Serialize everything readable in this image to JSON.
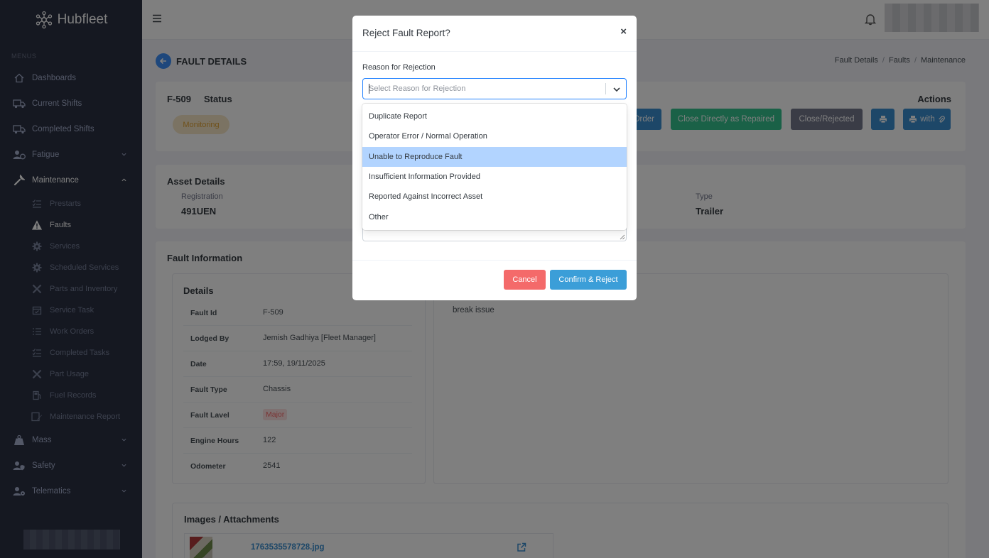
{
  "app": {
    "name": "Hubfleet"
  },
  "sidebar": {
    "menu_title": "MENUS",
    "items": [
      {
        "label": "Dashboards",
        "icon": "home-icon"
      },
      {
        "label": "Current Shifts",
        "icon": "truck-icon"
      },
      {
        "label": "Completed Shifts",
        "icon": "truck-icon"
      },
      {
        "label": "Fatigue",
        "icon": "user-clock-icon",
        "expandable": true
      },
      {
        "label": "Maintenance",
        "icon": "wrench-icon",
        "expandable": true,
        "expanded": true
      }
    ],
    "maintenance_sub": [
      {
        "label": "Prestarts",
        "icon": "checklist-icon"
      },
      {
        "label": "Faults",
        "icon": "warning-icon",
        "active": true
      },
      {
        "label": "Services",
        "icon": "gear-icon"
      },
      {
        "label": "Scheduled Services",
        "icon": "gear-icon"
      },
      {
        "label": "Parts and Inventory",
        "icon": "tools-icon"
      },
      {
        "label": "Service Task",
        "icon": "calendar-check-icon"
      },
      {
        "label": "Work Orders",
        "icon": "list-icon"
      },
      {
        "label": "Completed Tasks",
        "icon": "checklist-icon"
      },
      {
        "label": "Part Usage",
        "icon": "tools-icon"
      },
      {
        "label": "Fuel Records",
        "icon": "fuel-icon"
      },
      {
        "label": "Maintenance Report",
        "icon": "report-icon"
      }
    ],
    "bottom_items": [
      {
        "label": "Mass",
        "icon": "weight-icon"
      },
      {
        "label": "Safety",
        "icon": "user-shield-icon"
      },
      {
        "label": "Telematics",
        "icon": "user-gear-icon"
      }
    ]
  },
  "page": {
    "title": "FAULT DETAILS",
    "breadcrumb": [
      "Fault Details",
      "Faults",
      "Maintenance"
    ]
  },
  "fault": {
    "id": "F-509",
    "status_label": "Status",
    "status": "Monitoring",
    "actions_title": "Actions",
    "actions": {
      "order": "Order",
      "repaired": "Close Directly as Repaired",
      "rejected": "Close/Rejected",
      "print_with": "with"
    }
  },
  "asset": {
    "title": "Asset Details",
    "registration_label": "Registration",
    "registration": "491UEN",
    "type_label": "Type",
    "type": "Trailer"
  },
  "fault_info": {
    "title": "Fault Information",
    "details_title": "Details",
    "rows": [
      {
        "k": "Fault Id",
        "v": "F-509"
      },
      {
        "k": "Lodged By",
        "v": "Jemish Gadhiya [Fleet Manager]"
      },
      {
        "k": "Date",
        "v": "17:59, 19/11/2025"
      },
      {
        "k": "Fault Type",
        "v": "Chassis"
      },
      {
        "k": "Fault Lavel",
        "v": "Major"
      },
      {
        "k": "Engine Hours",
        "v": "122"
      },
      {
        "k": "Odometer",
        "v": "2541"
      }
    ],
    "description": "break issue"
  },
  "attachments": {
    "title": "Images / Attachments",
    "files": [
      {
        "name": "1763535578728.jpg"
      }
    ]
  },
  "modal": {
    "title": "Reject Fault Report?",
    "close": "×",
    "reason_label": "Reason for Rejection",
    "select_placeholder": "Select Reason for Rejection",
    "options": [
      "Duplicate Report",
      "Operator Error / Normal Operation",
      "Unable to Reproduce Fault",
      "Insufficient Information Provided",
      "Reported Against Incorrect Asset",
      "Other"
    ],
    "focused_option": "Unable to Reproduce Fault",
    "cancel": "Cancel",
    "confirm": "Confirm & Reject"
  },
  "colors": {
    "sidebar_bg": "#2a3042",
    "primary": "#3b8fd0",
    "success": "#34c38f",
    "secondary": "#74788d",
    "danger": "#f46a6a",
    "warning_badge": "#f6e7c7",
    "select_focus": "#2684ff",
    "option_focus": "#b2d4ff"
  }
}
